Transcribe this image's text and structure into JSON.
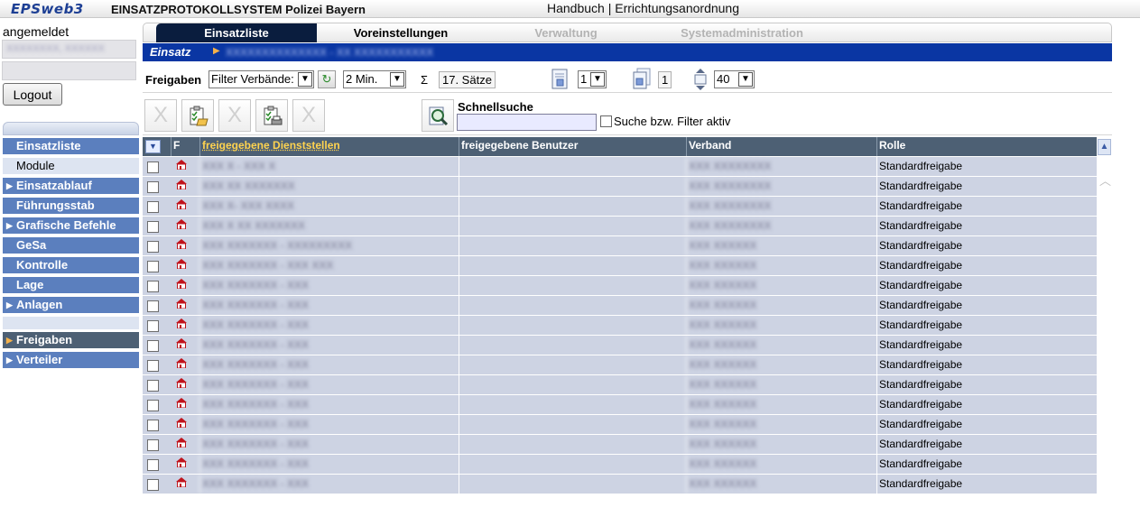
{
  "header": {
    "logo": "EPSweb3",
    "system_name": "EINSATZPROTOKOLLSYSTEM Polizei Bayern",
    "link_handbuch": "Handbuch",
    "separator": " | ",
    "link_errichtung": "Errichtungsanordnung"
  },
  "user": {
    "label": "angemeldet",
    "name": "XXXXXXXX, XXXXXX",
    "logout_label": "Logout"
  },
  "menu": [
    {
      "label": "Einsatzliste",
      "style": "blue",
      "arrow": false
    },
    {
      "label": "Module",
      "style": "plain",
      "arrow": false
    },
    {
      "label": "Einsatzablauf",
      "style": "blue",
      "arrow": true
    },
    {
      "label": "Führungsstab",
      "style": "blue",
      "arrow": false
    },
    {
      "label": "Grafische Befehle",
      "style": "blue",
      "arrow": true
    },
    {
      "label": "GeSa",
      "style": "blue",
      "arrow": false
    },
    {
      "label": "Kontrolle",
      "style": "blue",
      "arrow": false
    },
    {
      "label": "Lage",
      "style": "blue",
      "arrow": false
    },
    {
      "label": "Anlagen",
      "style": "blue",
      "arrow": true
    },
    {
      "label": "",
      "style": "spacer",
      "arrow": false
    },
    {
      "label": "Freigaben",
      "style": "active",
      "arrow": true
    },
    {
      "label": "Verteiler",
      "style": "blue",
      "arrow": true
    }
  ],
  "tabs": [
    {
      "label": "Einsatzliste",
      "state": "active"
    },
    {
      "label": "Voreinstellungen",
      "state": "normal"
    },
    {
      "label": "Verwaltung",
      "state": "disabled"
    },
    {
      "label": "Systemadministration",
      "state": "disabled"
    }
  ],
  "breadcrumb": {
    "label": "Einsatz",
    "value": "XXXXXXXXXXXXXX - XX XXXXXXXXXXX"
  },
  "toolbar": {
    "freigaben_label": "Freigaben",
    "filter_select": "Filter Verbände:",
    "interval_select": "2 Min.",
    "sigma": "Σ",
    "count": "17. Sätze",
    "page_select": "1",
    "page_total": "1",
    "page_size_select": "40",
    "quicksearch_label": "Schnellsuche",
    "quicksearch_value": "",
    "filter_active_label": "Suche bzw. Filter aktiv"
  },
  "table": {
    "headers": {
      "f": "F",
      "dienststellen": "freigegebene Dienststellen",
      "benutzer": "freigegebene Benutzer",
      "verband": "Verband",
      "rolle": "Rolle"
    },
    "rows": [
      {
        "dienststelle": "XXX X - XXX X",
        "benutzer": "",
        "verband": "XXX XXXXXXXX",
        "rolle": "Standardfreigabe"
      },
      {
        "dienststelle": "XXX XX XXXXXXX",
        "benutzer": "",
        "verband": "XXX XXXXXXXX",
        "rolle": "Standardfreigabe"
      },
      {
        "dienststelle": "XXX X- XXX XXXX",
        "benutzer": "",
        "verband": "XXX XXXXXXXX",
        "rolle": "Standardfreigabe"
      },
      {
        "dienststelle": "XXX X XX XXXXXXX",
        "benutzer": "",
        "verband": "XXX XXXXXXXX",
        "rolle": "Standardfreigabe"
      },
      {
        "dienststelle": "XXX XXXXXXX - XXXXXXXXX",
        "benutzer": "",
        "verband": "XXX XXXXXX",
        "rolle": "Standardfreigabe"
      },
      {
        "dienststelle": "XXX XXXXXXX - XXX XXX",
        "benutzer": "",
        "verband": "XXX XXXXXX",
        "rolle": "Standardfreigabe"
      },
      {
        "dienststelle": "XXX XXXXXXX - XXX",
        "benutzer": "",
        "verband": "XXX XXXXXX",
        "rolle": "Standardfreigabe"
      },
      {
        "dienststelle": "XXX XXXXXXX - XXX",
        "benutzer": "",
        "verband": "XXX XXXXXX",
        "rolle": "Standardfreigabe"
      },
      {
        "dienststelle": "XXX XXXXXXX - XXX",
        "benutzer": "",
        "verband": "XXX XXXXXX",
        "rolle": "Standardfreigabe"
      },
      {
        "dienststelle": "XXX XXXXXXX - XXX",
        "benutzer": "",
        "verband": "XXX XXXXXX",
        "rolle": "Standardfreigabe"
      },
      {
        "dienststelle": "XXX XXXXXXX - XXX",
        "benutzer": "",
        "verband": "XXX XXXXXX",
        "rolle": "Standardfreigabe"
      },
      {
        "dienststelle": "XXX XXXXXXX - XXX",
        "benutzer": "",
        "verband": "XXX XXXXXX",
        "rolle": "Standardfreigabe"
      },
      {
        "dienststelle": "XXX XXXXXXX - XXX",
        "benutzer": "",
        "verband": "XXX XXXXXX",
        "rolle": "Standardfreigabe"
      },
      {
        "dienststelle": "XXX XXXXXXX - XXX",
        "benutzer": "",
        "verband": "XXX XXXXXX",
        "rolle": "Standardfreigabe"
      },
      {
        "dienststelle": "XXX XXXXXXX - XXX",
        "benutzer": "",
        "verband": "XXX XXXXXX",
        "rolle": "Standardfreigabe"
      },
      {
        "dienststelle": "XXX XXXXXXX - XXX",
        "benutzer": "",
        "verband": "XXX XXXXXX",
        "rolle": "Standardfreigabe"
      },
      {
        "dienststelle": "XXX XXXXXXX - XXX",
        "benutzer": "",
        "verband": "XXX XXXXXX",
        "rolle": "Standardfreigabe"
      }
    ]
  },
  "icons": {
    "refresh": "refresh-icon",
    "freigabe_row": "house-icon",
    "quicksearch": "magnifier-icon",
    "page": "page-icon",
    "pages": "pages-icon",
    "pagesize": "resize-vertical-icon"
  },
  "colors": {
    "header_dark": "#0a1d3e",
    "breadcrumb_blue": "#0a36a3",
    "menu_blue": "#5b7fbe",
    "table_header": "#4d6074",
    "row_bg": "#cdd3e3",
    "accent_orange": "#f4b14a"
  }
}
